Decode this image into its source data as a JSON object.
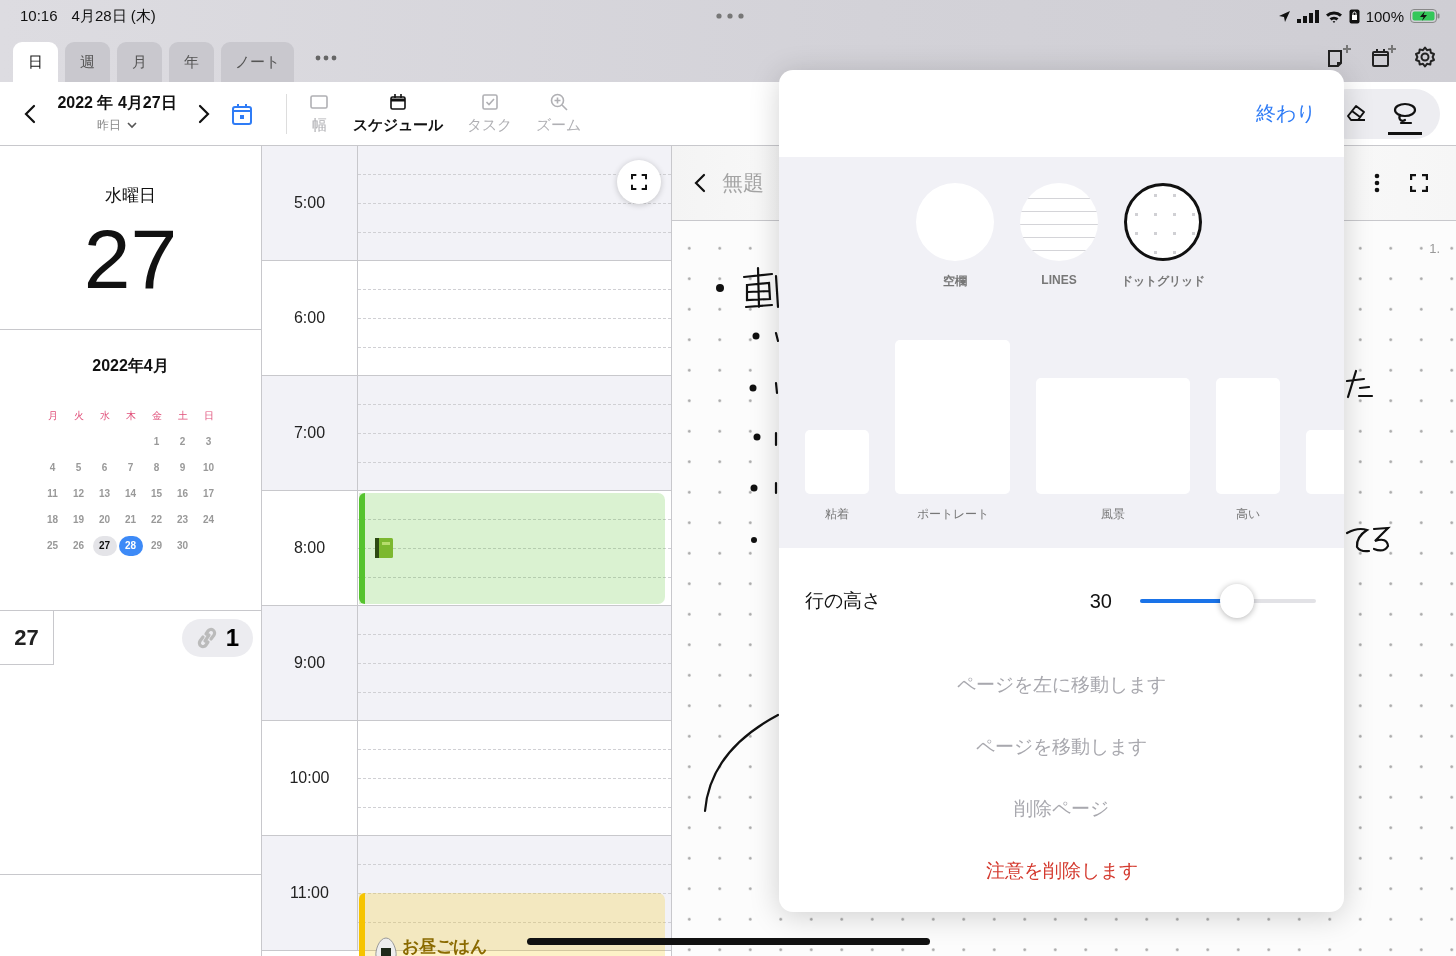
{
  "status_bar": {
    "time": "10:16",
    "date": "4月28日 (木)",
    "battery": "100%"
  },
  "view_tabs": [
    {
      "label": "日",
      "selected": true
    },
    {
      "label": "週",
      "selected": false
    },
    {
      "label": "月",
      "selected": false
    },
    {
      "label": "年",
      "selected": false
    },
    {
      "label": "ノート",
      "selected": false
    }
  ],
  "date_nav": {
    "date": "2022 年 4月27日",
    "relative_day": "昨日"
  },
  "view_tools": [
    {
      "kind": "width",
      "label": "幅",
      "selected": false
    },
    {
      "kind": "schedule",
      "label": "スケジュール",
      "selected": true
    },
    {
      "kind": "task",
      "label": "タスク",
      "selected": false
    },
    {
      "kind": "zoom",
      "label": "ズーム",
      "selected": false
    }
  ],
  "pen_tools": [
    {
      "kind": "eraser",
      "selected": false
    },
    {
      "kind": "lasso",
      "selected": true
    }
  ],
  "day_header": {
    "weekday": "水曜日",
    "day": "27"
  },
  "mini_calendar": {
    "title": "2022年4月",
    "weekdays": [
      "月",
      "火",
      "水",
      "木",
      "金",
      "土",
      "日"
    ],
    "weeks": [
      [
        {
          "day": "1",
          "selected": false,
          "today": false
        },
        {
          "day": "2",
          "selected": false,
          "today": false
        },
        {
          "day": "3",
          "selected": false,
          "today": false
        }
      ],
      [
        {
          "day": "4",
          "selected": false,
          "today": false
        },
        {
          "day": "5",
          "selected": false,
          "today": false
        },
        {
          "day": "6",
          "selected": false,
          "today": false
        },
        {
          "day": "7",
          "selected": false,
          "today": false
        },
        {
          "day": "8",
          "selected": false,
          "today": false
        },
        {
          "day": "9",
          "selected": false,
          "today": false
        },
        {
          "day": "10",
          "selected": false,
          "today": false
        }
      ],
      [
        {
          "day": "11",
          "selected": false,
          "today": false
        },
        {
          "day": "12",
          "selected": false,
          "today": false
        },
        {
          "day": "13",
          "selected": false,
          "today": false
        },
        {
          "day": "14",
          "selected": false,
          "today": false
        },
        {
          "day": "15",
          "selected": false,
          "today": false
        },
        {
          "day": "16",
          "selected": false,
          "today": false
        },
        {
          "day": "17",
          "selected": false,
          "today": false
        }
      ],
      [
        {
          "day": "18",
          "selected": false,
          "today": false
        },
        {
          "day": "19",
          "selected": false,
          "today": false
        },
        {
          "day": "20",
          "selected": false,
          "today": false
        },
        {
          "day": "21",
          "selected": false,
          "today": false
        },
        {
          "day": "22",
          "selected": false,
          "today": false
        },
        {
          "day": "23",
          "selected": false,
          "today": false
        },
        {
          "day": "24",
          "selected": false,
          "today": false
        }
      ],
      [
        {
          "day": "25",
          "selected": false,
          "today": false
        },
        {
          "day": "26",
          "selected": false,
          "today": false
        },
        {
          "day": "27",
          "selected": true,
          "today": false
        },
        {
          "day": "28",
          "selected": false,
          "today": true
        },
        {
          "day": "29",
          "selected": false,
          "today": false
        },
        {
          "day": "30",
          "selected": false,
          "today": false
        }
      ]
    ]
  },
  "day_badge": {
    "day": "27",
    "link_count": "1"
  },
  "schedule": {
    "hours": [
      {
        "label": "5:00"
      },
      {
        "label": "6:00"
      },
      {
        "label": "7:00"
      },
      {
        "label": "8:00",
        "event": {
          "kind": "study",
          "color": "#55c32e"
        }
      },
      {
        "label": "9:00"
      },
      {
        "label": "10:00"
      },
      {
        "label": "11:00",
        "event": {
          "kind": "meal",
          "color": "#f6c400",
          "title": "お昼ごはん"
        }
      }
    ]
  },
  "note": {
    "title": "無題",
    "page_number": "1."
  },
  "template_sheet": {
    "done": "終わり",
    "patterns": [
      {
        "kind": "blank",
        "label": "空欄",
        "selected": false
      },
      {
        "kind": "lines",
        "label": "LINES",
        "selected": false
      },
      {
        "kind": "dots",
        "label": "ドットグリッド",
        "selected": true
      }
    ],
    "sizes": [
      {
        "kind": "sticky",
        "label": "粘着"
      },
      {
        "kind": "portrait",
        "label": "ポートレート"
      },
      {
        "kind": "landscape",
        "label": "風景"
      },
      {
        "kind": "tall",
        "label": "高い"
      },
      {
        "kind": "sticky"
      }
    ],
    "line_height": {
      "label": "行の高さ",
      "value": "30",
      "level": 0.56
    },
    "actions": [
      {
        "kind": "normal",
        "label": "ページを左に移動します",
        "disabled": true
      },
      {
        "kind": "normal",
        "label": "ページを移動します",
        "disabled": true
      },
      {
        "kind": "normal",
        "label": "削除ページ",
        "disabled": true
      },
      {
        "kind": "destructive",
        "label": "注意を削除します",
        "disabled": false
      }
    ]
  }
}
